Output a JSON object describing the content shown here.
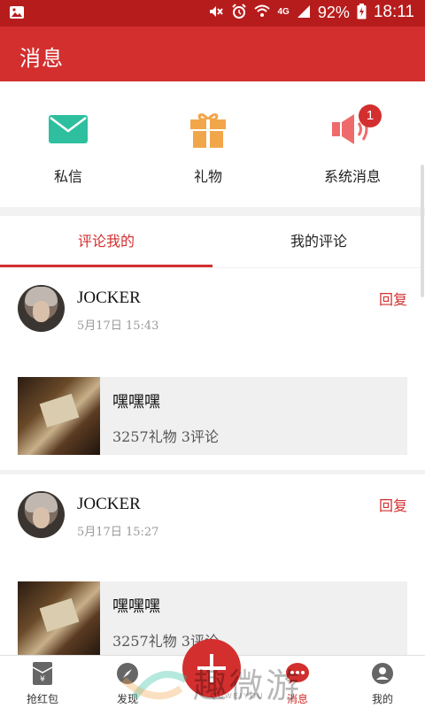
{
  "status_bar": {
    "battery_pct": "92%",
    "network": "4G",
    "clock": "18:11"
  },
  "app_bar": {
    "title": "消息"
  },
  "quick_actions": [
    {
      "label": "私信",
      "icon": "mail-icon",
      "color": "#2ebf9f"
    },
    {
      "label": "礼物",
      "icon": "gift-icon",
      "color": "#f2a64a"
    },
    {
      "label": "系统消息",
      "icon": "speaker-icon",
      "color": "#ef6b6b",
      "badge": "1"
    }
  ],
  "tabs": [
    {
      "label": "评论我的",
      "active": true
    },
    {
      "label": "我的评论",
      "active": false
    }
  ],
  "comments": [
    {
      "user": "JOCKER",
      "time": "5月17日  15:43",
      "reply_label": "回复",
      "post": {
        "title": "嘿嘿嘿",
        "meta": "3257礼物  3评论"
      }
    },
    {
      "user": "JOCKER",
      "time": "5月17日  15:27",
      "reply_label": "回复",
      "post": {
        "title": "嘿嘿嘿",
        "meta": "3257礼物  3评论"
      }
    }
  ],
  "bottom_nav": [
    {
      "label": "抢红包",
      "icon": "red-envelope-icon"
    },
    {
      "label": "发现",
      "icon": "compass-icon"
    },
    {
      "label": "",
      "icon": "plus-icon"
    },
    {
      "label": "消息",
      "icon": "chat-icon",
      "active": true
    },
    {
      "label": "我的",
      "icon": "user-icon"
    }
  ],
  "watermark": {
    "text": "趣微游",
    "sub": "QUWEIYOU"
  },
  "colors": {
    "primary": "#d32f2f",
    "statusbar": "#b71c1c"
  }
}
